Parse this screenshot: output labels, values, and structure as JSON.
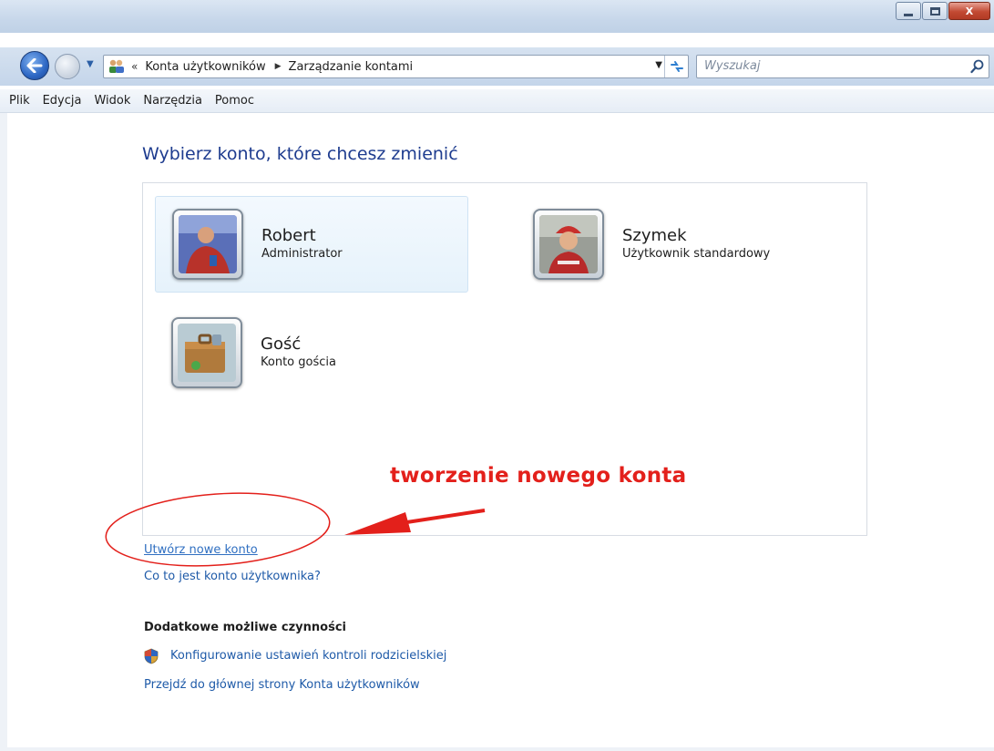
{
  "window": {
    "minimize_icon": "minimize-icon",
    "maximize_icon": "maximize-icon",
    "close_glyph": "X"
  },
  "nav": {
    "address_chevron": "«",
    "breadcrumb": [
      "Konta użytkowników",
      "Zarządzanie kontami"
    ],
    "search_placeholder": "Wyszukaj"
  },
  "menu": [
    "Plik",
    "Edycja",
    "Widok",
    "Narzędzia",
    "Pomoc"
  ],
  "main": {
    "title": "Wybierz konto, które chcesz zmienić",
    "accounts": [
      {
        "name": "Robert",
        "type": "Administrator",
        "avatar": "user-photo-robert",
        "selected": true
      },
      {
        "name": "Szymek",
        "type": "Użytkownik standardowy",
        "avatar": "user-photo-szymek",
        "selected": false
      },
      {
        "name": "Gość",
        "type": "Konto gościa",
        "avatar": "guest-briefcase-icon",
        "selected": false
      }
    ],
    "links": {
      "create_account": "Utwórz nowe konto",
      "what_is_account": "Co to jest konto użytkownika?"
    },
    "additional": {
      "heading": "Dodatkowe możliwe czynności",
      "parental": "Konfigurowanie ustawień kontroli rodzicielskiej",
      "main_page": "Przejdź do głównej strony Konta użytkowników"
    }
  },
  "annotation": {
    "text": "tworzenie nowego konta",
    "color": "#e3201b"
  },
  "colors": {
    "link": "#1e5aa8",
    "title": "#1e3c8f"
  }
}
